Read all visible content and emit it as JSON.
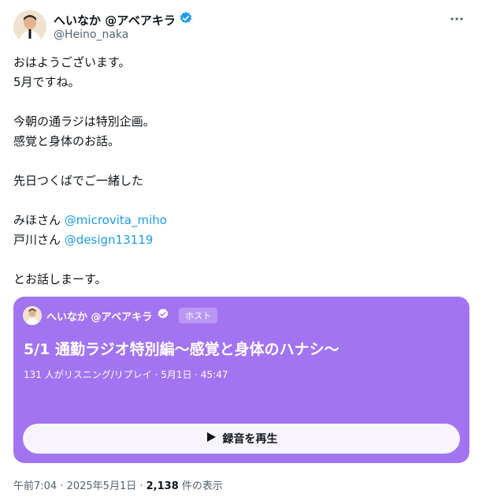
{
  "author": {
    "display_name": "へいなか @アベアキラ",
    "handle": "@Heino_naka"
  },
  "icons": {
    "verified": "verified-badge-icon",
    "more": "more-dots-icon",
    "play": "play-icon"
  },
  "colors": {
    "mention": "#1d9bf0",
    "verified": "#1d9bf0",
    "space_card": "#a374f1"
  },
  "body": {
    "lines": [
      "おはようございます。",
      "5月ですね。",
      "",
      "今朝の通ラジは特別企画。",
      "感覚と身体のお話。",
      "",
      "先日つくばでご一緒した",
      "",
      "みほさん",
      "戸川さん",
      "",
      "とお話しまーす。"
    ],
    "mention_1": "@microvita_miho",
    "mention_2": "@design13119"
  },
  "space": {
    "host_name": "へいなか @アベアキラ",
    "host_badge": "ホスト",
    "title": "5/1 通勤ラジオ特別編〜感覚と身体のハナシ〜",
    "meta": "131 人がリスニング/リプレイ · 5月1日 · 45:47",
    "play_label": "録音を再生"
  },
  "footer": {
    "time_date": "午前7:04 · 2025年5月1日 · ",
    "views_count": "2,138",
    "views_label": " 件の表示"
  }
}
